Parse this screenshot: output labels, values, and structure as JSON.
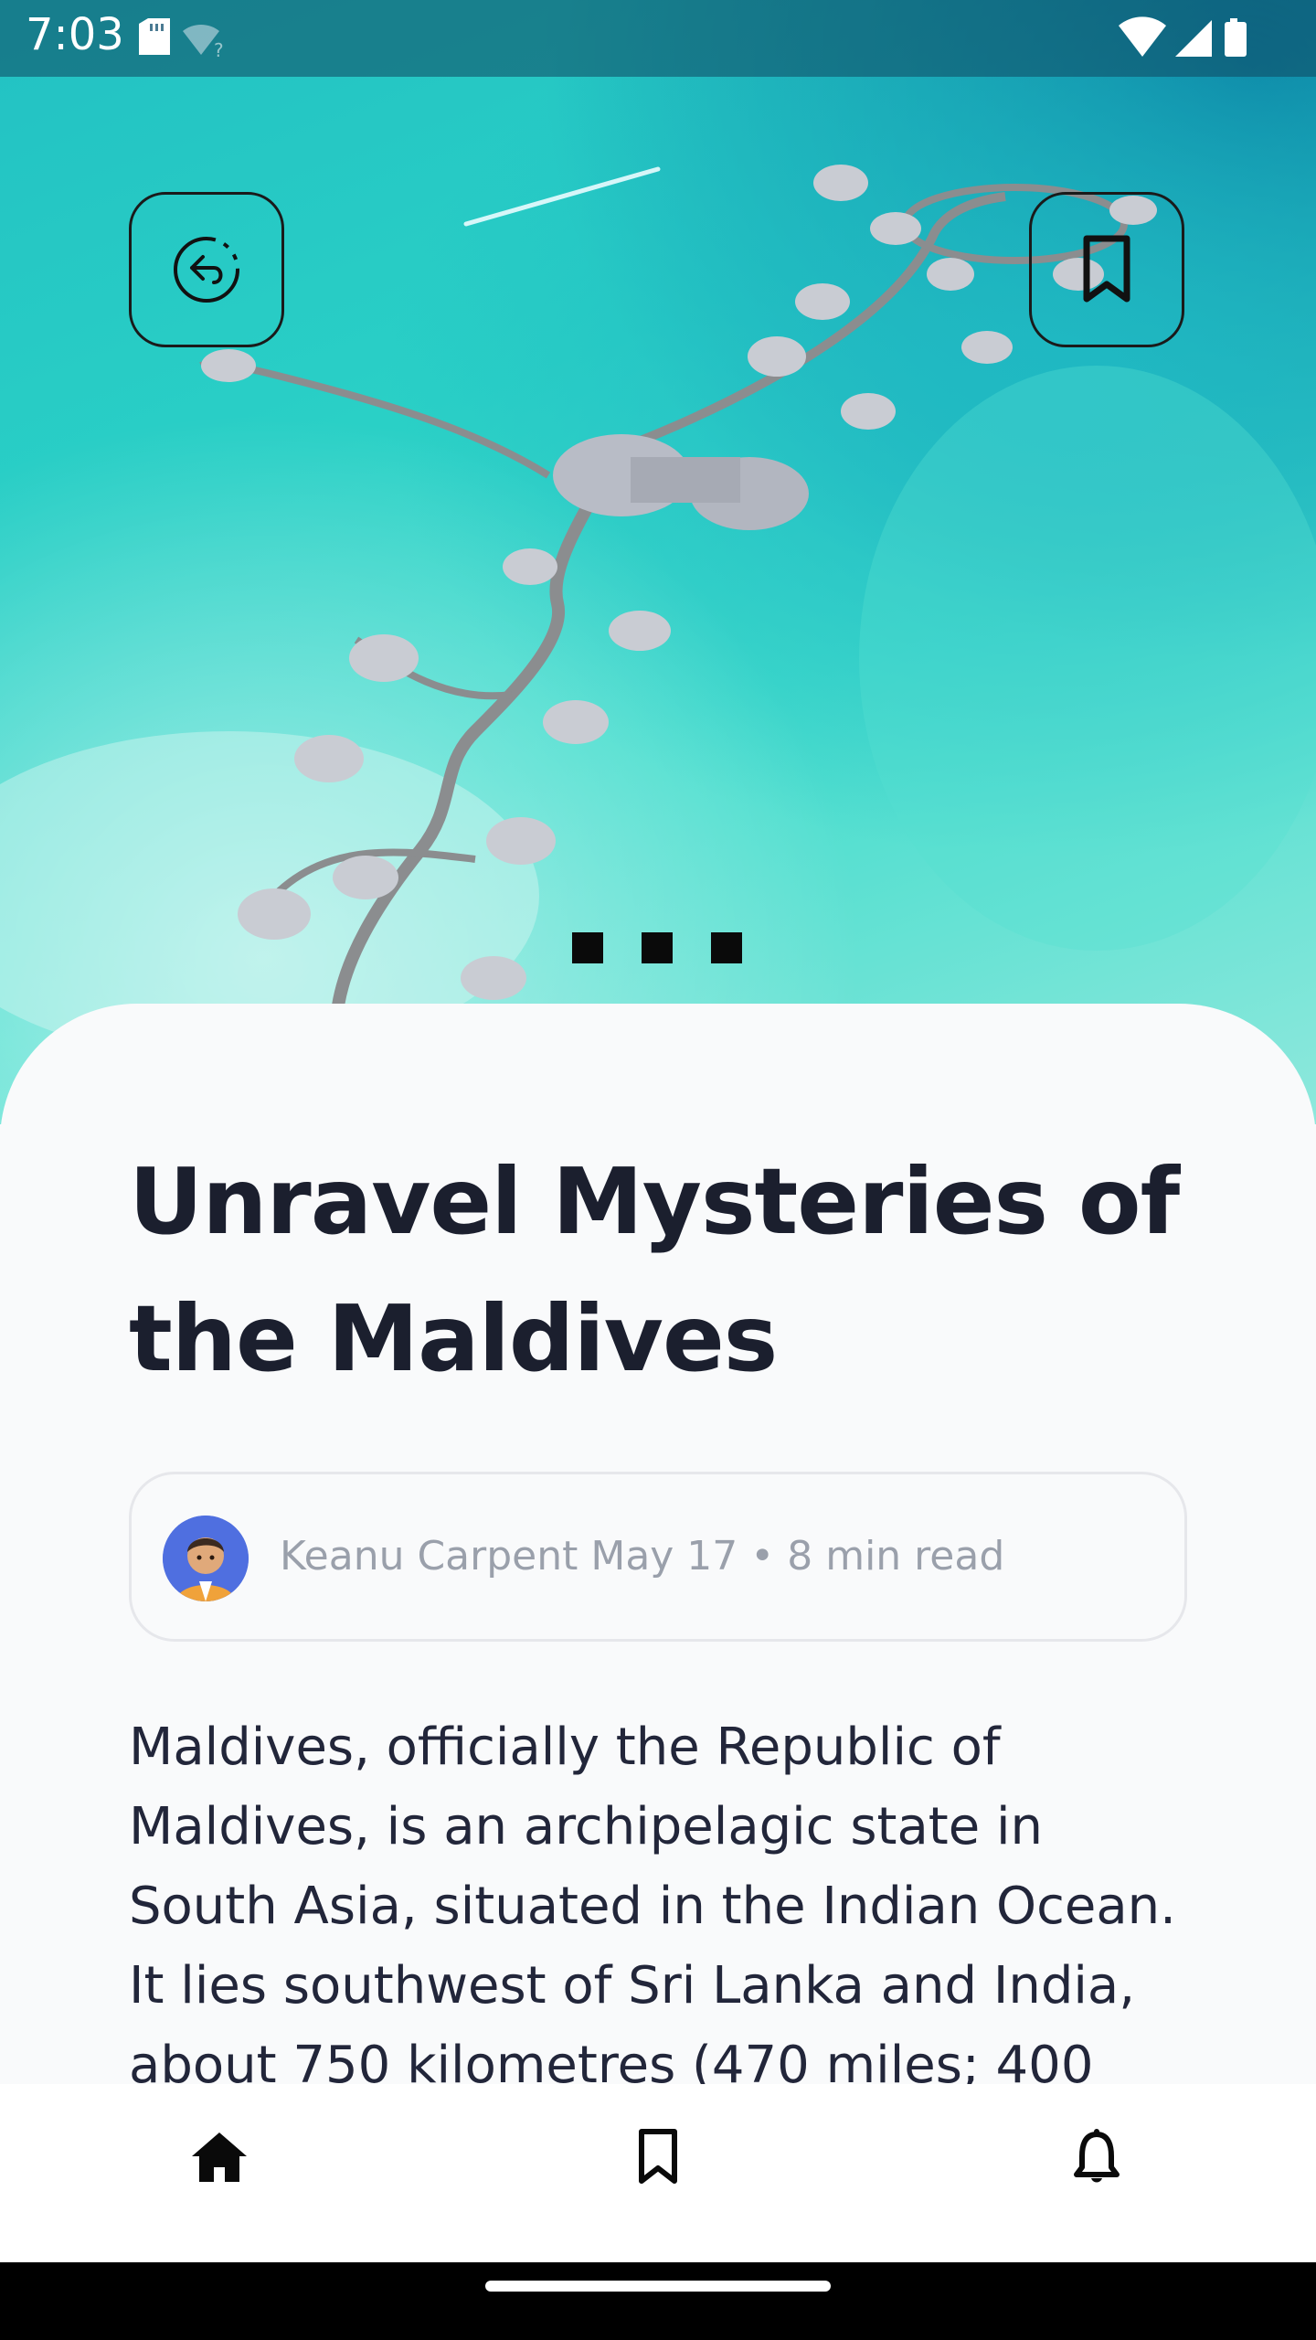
{
  "status_bar": {
    "time": "7:03",
    "icons_left": [
      "sd-card-icon",
      "wifi-unknown-icon"
    ],
    "icons_right": [
      "wifi-icon",
      "signal-icon",
      "battery-icon"
    ]
  },
  "hero": {
    "image": "maldives-overwater-villas-aerial",
    "carousel_pages": 3
  },
  "article": {
    "title": "Unravel Mysteries of the Maldives",
    "author_meta": "Keanu Carpent May 17 • 8 min read",
    "body": "Maldives, officially the Republic of Maldives, is an archipelagic state in South Asia, situated in the Indian Ocean. It lies southwest of Sri Lanka and India, about 750 kilometres (470 miles; 400"
  },
  "bottom_nav": {
    "items": [
      "home-icon",
      "bookmark-icon",
      "bell-icon"
    ]
  },
  "colors": {
    "title": "#1b1f2e",
    "meta": "#9aa0ab",
    "sheet_bg": "#f9fafb",
    "water": "#2ad0c6"
  }
}
